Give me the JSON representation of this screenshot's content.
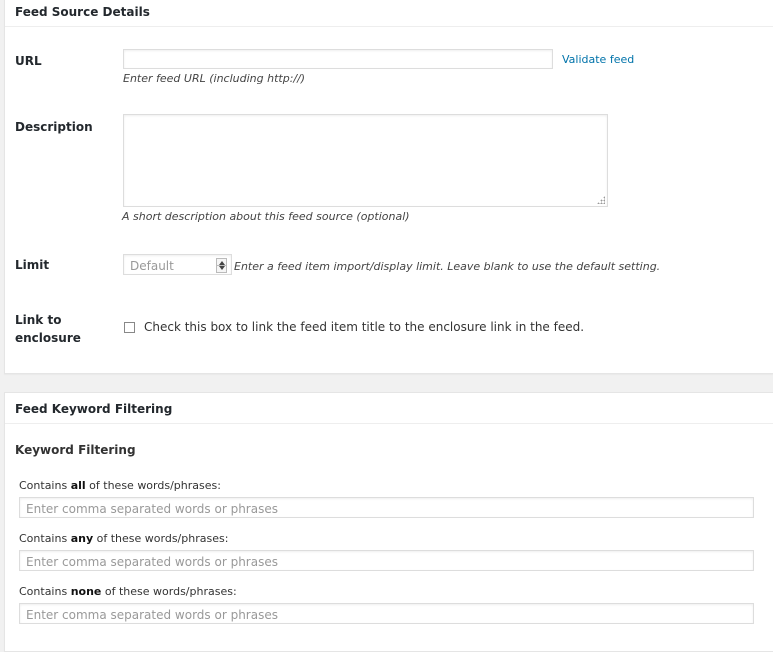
{
  "feed_source": {
    "title": "Feed Source Details",
    "url": {
      "label": "URL",
      "value": "",
      "validate_link": "Validate feed",
      "help": "Enter feed URL (including http://)"
    },
    "description": {
      "label": "Description",
      "value": "",
      "help": "A short description about this feed source (optional)"
    },
    "limit": {
      "label": "Limit",
      "placeholder": "Default",
      "help": "Enter a feed item import/display limit. Leave blank to use the default setting."
    },
    "link_enclosure": {
      "label_line1": "Link to",
      "label_line2": "enclosure",
      "checked": false,
      "checkbox_text": "Check this box to link the feed item title to the enclosure link in the feed."
    }
  },
  "keyword_filtering": {
    "title": "Feed Keyword Filtering",
    "section_label": "Keyword Filtering",
    "contains_all": {
      "prefix": "Contains ",
      "emphasis": "all",
      "suffix": " of these words/phrases:",
      "placeholder": "Enter comma separated words or phrases"
    },
    "contains_any": {
      "prefix": "Contains ",
      "emphasis": "any",
      "suffix": " of these words/phrases:",
      "placeholder": "Enter comma separated words or phrases"
    },
    "contains_none": {
      "prefix": "Contains ",
      "emphasis": "none",
      "suffix": " of these words/phrases:",
      "placeholder": "Enter comma separated words or phrases"
    }
  }
}
